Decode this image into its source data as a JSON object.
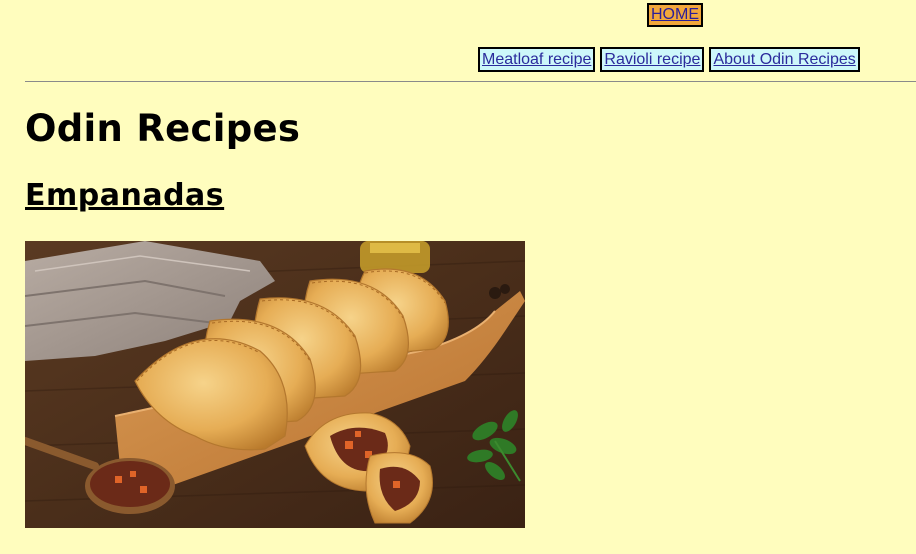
{
  "header": {
    "home_label": "HOME"
  },
  "nav": {
    "items": [
      {
        "label": "Meatloaf recipe"
      },
      {
        "label": "Ravioli recipe"
      },
      {
        "label": "About Odin Recipes"
      }
    ]
  },
  "main": {
    "site_title": "Odin Recipes",
    "recipe_title": "Empanadas"
  },
  "colors": {
    "background": "#FFFDBE",
    "home_button_bg": "#F2A73B",
    "nav_button_bg": "#CDF7FA",
    "link_text": "#2B2B9C"
  }
}
